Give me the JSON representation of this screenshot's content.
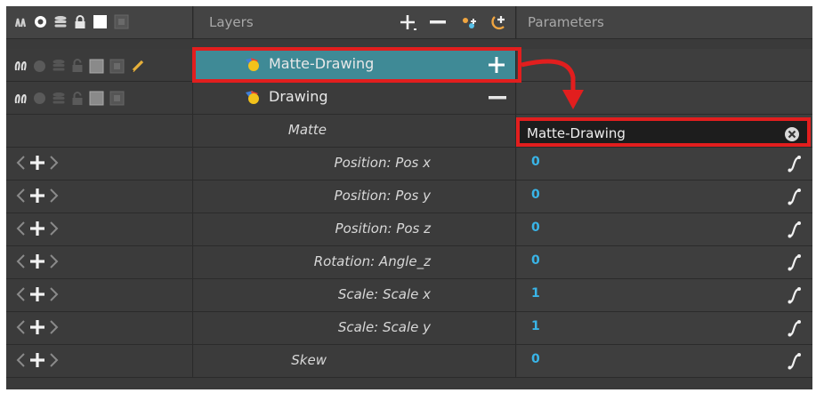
{
  "header": {
    "layers_title": "Layers",
    "parameters_title": "Parameters"
  },
  "layers": [
    {
      "name": "Matte-Drawing",
      "selected": true,
      "toggle": "+"
    },
    {
      "name": "Drawing",
      "selected": false,
      "toggle": "-"
    }
  ],
  "matte_row": {
    "label": "Matte",
    "value": "Matte-Drawing"
  },
  "attributes": [
    {
      "label": "Position: Pos x",
      "value": "0"
    },
    {
      "label": "Position: Pos y",
      "value": "0"
    },
    {
      "label": "Position: Pos z",
      "value": "0"
    },
    {
      "label": "Rotation: Angle_z",
      "value": "0"
    },
    {
      "label": "Scale: Scale x",
      "value": "1"
    },
    {
      "label": "Scale: Scale y",
      "value": "1"
    },
    {
      "label": "Skew",
      "value": "0"
    }
  ],
  "colors": {
    "selection": "#3f8a96",
    "value_blue": "#39b5e8",
    "highlight_red": "#e21e1e"
  },
  "icons": [
    "onion-skin-icon",
    "visibility-icon",
    "layers-stack-icon",
    "lock-icon",
    "color-swatch-icon",
    "layer-lock-icon",
    "pencil-icon",
    "add-layer-icon",
    "remove-layer-icon",
    "add-peg-icon",
    "add-peg-layer-icon",
    "drawing-layer-icon",
    "clear-icon",
    "function-curve-icon"
  ]
}
